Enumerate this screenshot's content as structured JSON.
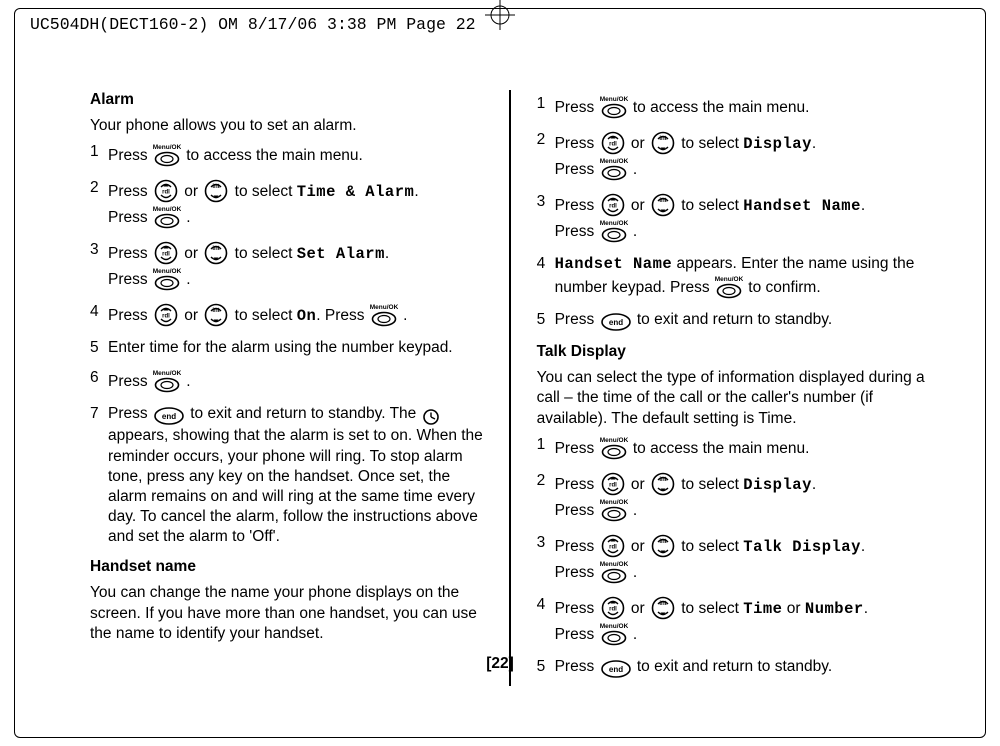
{
  "header_crop_line": "UC504DH(DECT160-2) OM  8/17/06  3:38 PM  Page 22",
  "page_number": "[22]",
  "icons": {
    "menu_ok": "Menu/OK",
    "up": "rdl",
    "down": "int",
    "end": "end",
    "clock": "clock-icon"
  },
  "left": {
    "alarm": {
      "heading": "Alarm",
      "intro": "Your phone allows you to set an alarm.",
      "steps": [
        {
          "n": "1",
          "pre": "Press ",
          "ic": "menu_ok",
          "post": " to access the main menu."
        },
        {
          "n": "2",
          "pre": "Press ",
          "ic": "up",
          "mid1": " or ",
          "ic2": "down",
          "mid2": " to select ",
          "code": "Time & Alarm",
          "post2": ".",
          "line2pre": "Press ",
          "line2ic": "menu_ok",
          "line2post": " ."
        },
        {
          "n": "3",
          "pre": "Press ",
          "ic": "up",
          "mid1": " or ",
          "ic2": "down",
          "mid2": " to select ",
          "code": "Set Alarm",
          "post2": ".",
          "line2pre": "Press ",
          "line2ic": "menu_ok",
          "line2post": " ."
        },
        {
          "n": "4",
          "pre": "Press ",
          "ic": "up",
          "mid1": " or ",
          "ic2": "down",
          "mid2": " to select ",
          "code": "On",
          "post2": ". Press ",
          "post2ic": "menu_ok",
          "post3": " ."
        },
        {
          "n": "5",
          "text": "Enter time for the alarm using the number keypad."
        },
        {
          "n": "6",
          "pre": "Press ",
          "ic": "menu_ok",
          "post": " ."
        },
        {
          "n": "7",
          "pre": "Press ",
          "ic": "end",
          "post": " to exit and return to standby. The ",
          "clock": true,
          "rest7": " appears, showing that the alarm is set to on. When the reminder occurs, your phone will ring. To stop alarm tone, press any key on the handset. Once set, the alarm remains on and will ring at the same time every day. To cancel the alarm, follow the instructions above and set the alarm to 'Off'."
        }
      ]
    },
    "handset": {
      "heading": "Handset name",
      "intro": "You can change the name your phone displays on the screen. If you have more than one handset, you can use the name to identify your handset."
    }
  },
  "right": {
    "handset_steps": [
      {
        "n": "1",
        "pre": "Press ",
        "ic": "menu_ok",
        "post": " to access the main menu."
      },
      {
        "n": "2",
        "pre": "Press ",
        "ic": "up",
        "mid1": " or ",
        "ic2": "down",
        "mid2": " to select ",
        "code": "Display",
        "post2": ".",
        "line2pre": "Press ",
        "line2ic": "menu_ok",
        "line2post": " ."
      },
      {
        "n": "3",
        "pre": "Press ",
        "ic": "up",
        "mid1": " or ",
        "ic2": "down",
        "mid2": " to select ",
        "code": "Handset Name",
        "post2": ".",
        "line2pre": "Press ",
        "line2ic": "menu_ok",
        "line2post": " ."
      },
      {
        "n": "4",
        "text_pre": "",
        "code": "Handset Name",
        "text_mid": " appears. Enter the name using the number keypad. Press ",
        "ic": "menu_ok",
        "text_post": " to confirm."
      },
      {
        "n": "5",
        "pre": "Press ",
        "ic": "end",
        "post": " to exit and return to standby."
      }
    ],
    "talk": {
      "heading": "Talk Display",
      "intro": "You can select the type of information displayed during a call – the time of the call or the caller's number (if available). The default setting is Time.",
      "steps": [
        {
          "n": "1",
          "pre": "Press ",
          "ic": "menu_ok",
          "post": " to access the main menu."
        },
        {
          "n": "2",
          "pre": "Press ",
          "ic": "up",
          "mid1": " or ",
          "ic2": "down",
          "mid2": " to select ",
          "code": "Display",
          "post2": ".",
          "line2pre": "Press ",
          "line2ic": "menu_ok",
          "line2post": " ."
        },
        {
          "n": "3",
          "pre": "Press ",
          "ic": "up",
          "mid1": " or ",
          "ic2": "down",
          "mid2": " to select ",
          "code": "Talk Display",
          "post2": ".",
          "line2pre": "Press ",
          "line2ic": "menu_ok",
          "line2post": " ."
        },
        {
          "n": "4",
          "pre": "Press ",
          "ic": "up",
          "mid1": " or ",
          "ic2": "down",
          "mid2": " to select ",
          "code": "Time",
          "mid3": " or ",
          "code2": "Number",
          "post2": ".",
          "line2pre": "Press ",
          "line2ic": "menu_ok",
          "line2post": " ."
        },
        {
          "n": "5",
          "pre": "Press ",
          "ic": "end",
          "post": " to exit and return to standby."
        }
      ]
    }
  }
}
